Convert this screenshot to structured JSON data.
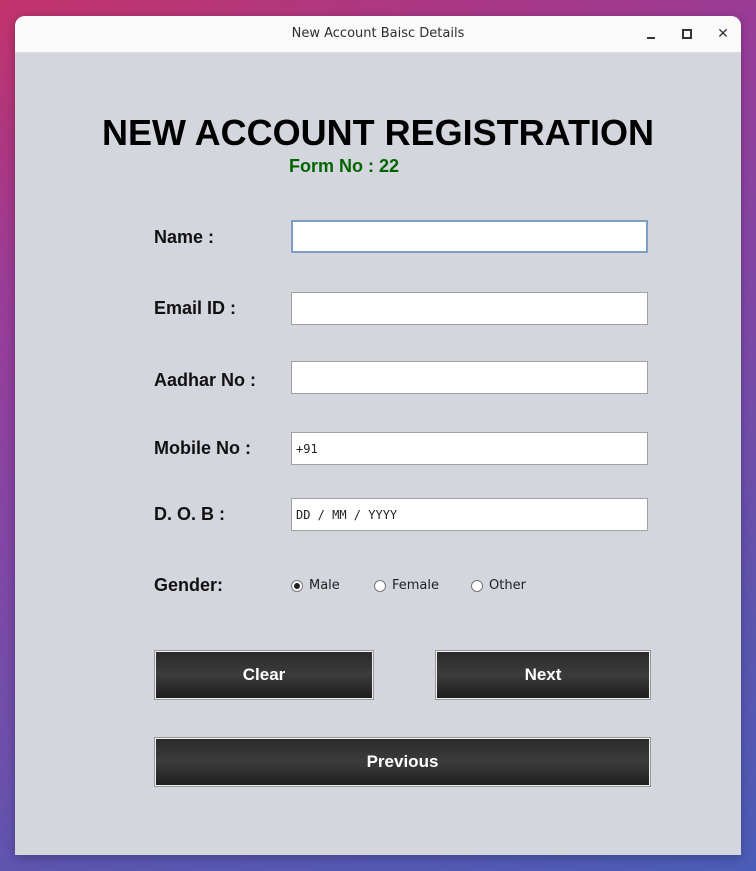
{
  "window": {
    "title": "New Account Baisc Details",
    "controls": {
      "minimize_icon": "minimize-icon",
      "maximize_icon": "maximize-icon",
      "close_icon": "close-icon",
      "close_glyph": "✕"
    }
  },
  "form": {
    "heading": "NEW ACCOUNT REGISTRATION",
    "form_no": "Form No : 22",
    "labels": {
      "name": "Name :",
      "email": "Email ID :",
      "aadhar": "Aadhar No :",
      "mobile": "Mobile No :",
      "dob": "D. O. B :",
      "gender": "Gender:"
    },
    "fields": {
      "name": "",
      "email": "",
      "aadhar": "",
      "mobile": "+91",
      "dob": "DD / MM / YYYY"
    },
    "gender_options": [
      {
        "label": "Male",
        "selected": true
      },
      {
        "label": "Female",
        "selected": false
      },
      {
        "label": "Other",
        "selected": false
      }
    ],
    "buttons": {
      "clear": "Clear",
      "next": "Next",
      "previous": "Previous"
    }
  },
  "colors": {
    "form_no": "#006400",
    "window_bg": "#d4d6dd",
    "button_bg": "#2b2b2b"
  }
}
